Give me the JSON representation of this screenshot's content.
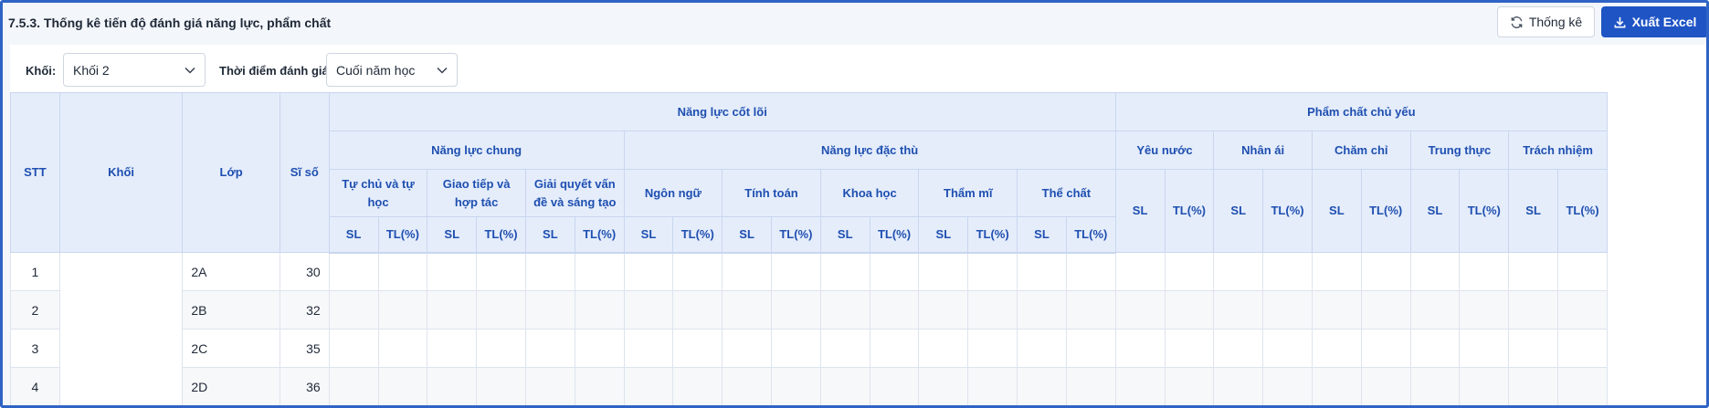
{
  "header": {
    "title": "7.5.3. Thống kê tiến độ đánh giá năng lực, phẩm chất",
    "stat_button": "Thống kê",
    "excel_button": "Xuất Excel"
  },
  "filters": {
    "grade_label": "Khối:",
    "grade_value": "Khối 2",
    "time_label": "Thời điểm đánh giá:",
    "time_value": "Cuối năm học"
  },
  "table": {
    "col_stt": "STT",
    "col_grade": "Khối",
    "col_class": "Lớp",
    "col_size": "Sĩ số",
    "group_core": "Năng lực cốt lõi",
    "group_quality": "Phẩm chất chủ yếu",
    "sub_general": "Năng lực chung",
    "sub_specific": "Năng lực đặc thù",
    "general": [
      "Tự chủ và tự học",
      "Giao tiếp và hợp tác",
      "Giải quyết vấn đề và sáng tạo"
    ],
    "specific": [
      "Ngôn ngữ",
      "Tính toán",
      "Khoa học",
      "Thẩm mĩ",
      "Thể chất"
    ],
    "qualities": [
      "Yêu nước",
      "Nhân ái",
      "Chăm chỉ",
      "Trung thực",
      "Trách nhiệm"
    ],
    "sl": "SL",
    "tl": "TL(%)",
    "rows": [
      {
        "stt": "1",
        "class": "2A",
        "size": "30"
      },
      {
        "stt": "2",
        "class": "2B",
        "size": "32"
      },
      {
        "stt": "3",
        "class": "2C",
        "size": "35"
      },
      {
        "stt": "4",
        "class": "2D",
        "size": "36"
      }
    ]
  }
}
